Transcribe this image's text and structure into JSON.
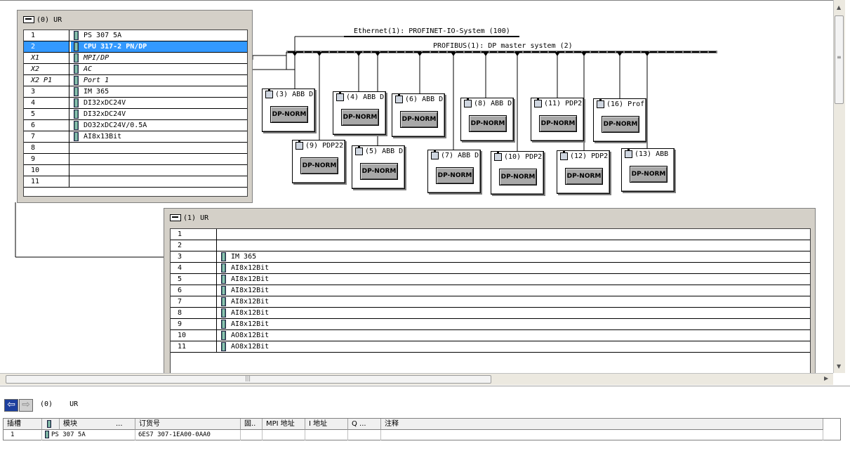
{
  "networks": {
    "ethernet": "Ethernet(1): PROFINET-IO-System (100)",
    "profibus": "PROFIBUS(1): DP master system (2)"
  },
  "rack0": {
    "title": "(0) UR",
    "rows": [
      {
        "slot": "1",
        "module": "PS 307 5A"
      },
      {
        "slot": "2",
        "module": "CPU 317-2 PN/DP"
      },
      {
        "slot": "X1",
        "module": "MPI/DP"
      },
      {
        "slot": "X2",
        "module": "AC"
      },
      {
        "slot": "X2 P1",
        "module": "Port 1"
      },
      {
        "slot": "3",
        "module": "IM 365"
      },
      {
        "slot": "4",
        "module": "DI32xDC24V"
      },
      {
        "slot": "5",
        "module": "DI32xDC24V"
      },
      {
        "slot": "6",
        "module": "DO32xDC24V/0.5A"
      },
      {
        "slot": "7",
        "module": "AI8x13Bit"
      },
      {
        "slot": "8",
        "module": ""
      },
      {
        "slot": "9",
        "module": ""
      },
      {
        "slot": "10",
        "module": ""
      },
      {
        "slot": "11",
        "module": ""
      }
    ]
  },
  "rack1": {
    "title": "(1) UR",
    "rows": [
      {
        "slot": "1",
        "module": ""
      },
      {
        "slot": "2",
        "module": ""
      },
      {
        "slot": "3",
        "module": "IM 365"
      },
      {
        "slot": "4",
        "module": "AI8x12Bit"
      },
      {
        "slot": "5",
        "module": "AI8x12Bit"
      },
      {
        "slot": "6",
        "module": "AI8x12Bit"
      },
      {
        "slot": "7",
        "module": "AI8x12Bit"
      },
      {
        "slot": "8",
        "module": "AI8x12Bit"
      },
      {
        "slot": "9",
        "module": "AI8x12Bit"
      },
      {
        "slot": "10",
        "module": "AO8x12Bit"
      },
      {
        "slot": "11",
        "module": "AO8x12Bit"
      }
    ]
  },
  "slaves": [
    {
      "label": "(3) ABB D",
      "type": "DP-NORM"
    },
    {
      "label": "(4) ABB D",
      "type": "DP-NORM"
    },
    {
      "label": "(6) ABB D",
      "type": "DP-NORM"
    },
    {
      "label": "(8) ABB D",
      "type": "DP-NORM"
    },
    {
      "label": "(11) PDP2",
      "type": "DP-NORM"
    },
    {
      "label": "(16) Prof",
      "type": "DP-NORM"
    },
    {
      "label": "(9) PDP22",
      "type": "DP-NORM"
    },
    {
      "label": "(5) ABB D",
      "type": "DP-NORM"
    },
    {
      "label": "(7) ABB D",
      "type": "DP-NORM"
    },
    {
      "label": "(10) PDP2",
      "type": "DP-NORM"
    },
    {
      "label": "(12) PDP2",
      "type": "DP-NORM"
    },
    {
      "label": "(13) ABB",
      "type": "DP-NORM"
    }
  ],
  "bottom": {
    "rack_path": [
      "(0)",
      "UR"
    ],
    "columns": [
      "插槽",
      "模块",
      "...",
      "订货号",
      "固..",
      "MPI 地址",
      "I 地址",
      "Q ...",
      "注释"
    ],
    "row": {
      "slot": "1",
      "module": "PS 307 5A",
      "order_no": "6ES7 307-1EA00-0AA0",
      "firmware": "",
      "mpi": "",
      "i_addr": "",
      "q_addr": "",
      "comment": ""
    }
  },
  "icons": {
    "nav_back": "arrow-left-icon",
    "nav_forward": "arrow-right-icon",
    "rack": "rack-icon",
    "module": "module-icon",
    "slave": "dp-slave-icon"
  }
}
